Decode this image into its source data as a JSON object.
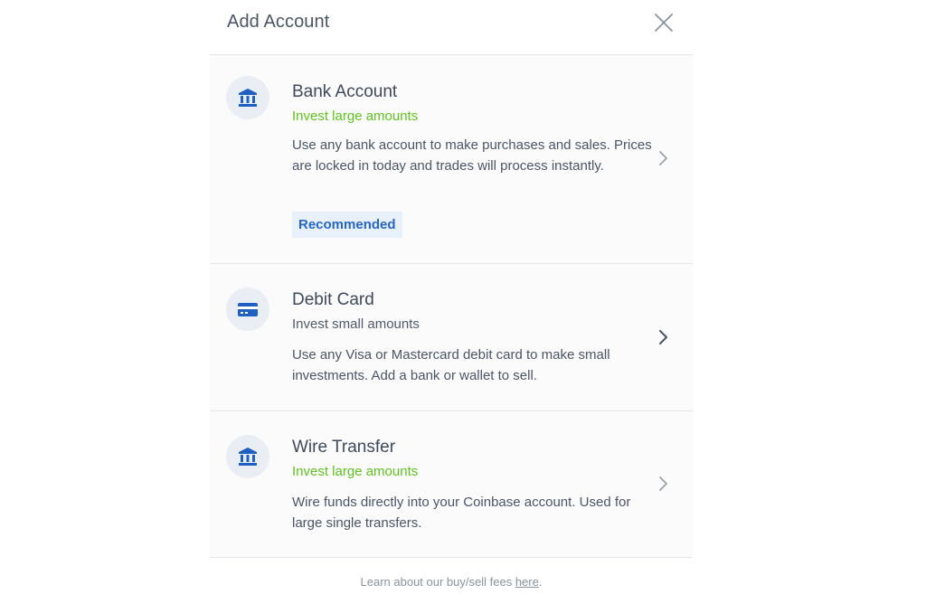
{
  "modal": {
    "title": "Add Account",
    "close_icon": "close-icon"
  },
  "options": [
    {
      "title": "Bank Account",
      "subtitle": "Invest large amounts",
      "subtitle_color": "#5fc31f",
      "description": "Use any bank account to make purchases and sales. Prices are locked in today and trades will process instantly.",
      "badge": "Recommended",
      "icon": "bank-icon"
    },
    {
      "title": "Debit Card",
      "subtitle": "Invest small amounts",
      "subtitle_color": "#4f5a6a",
      "description": "Use any Visa or Mastercard debit card to make small investments. Add a bank or wallet to sell.",
      "icon": "credit-card-icon"
    },
    {
      "title": "Wire Transfer",
      "subtitle": "Invest large amounts",
      "subtitle_color": "#5fc31f",
      "description": "Wire funds directly into your Coinbase account. Used for large single transfers.",
      "icon": "bank-icon"
    }
  ],
  "footer": {
    "text": "Learn about our buy/sell fees ",
    "link": "here",
    "suffix": "."
  },
  "colors": {
    "accent_blue": "#2667c4",
    "green": "#5fc31f",
    "icon_bg": "#e9eef5"
  }
}
